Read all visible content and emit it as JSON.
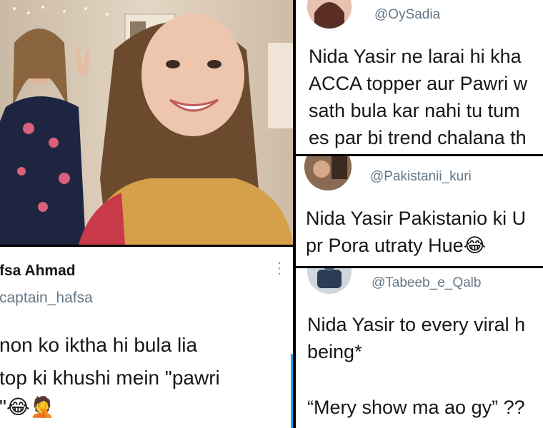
{
  "photo": {
    "description_icon": "photo-of-two-women"
  },
  "tweet_left": {
    "name": "fsa Ahmad",
    "handle": "captain_hafsa",
    "lines": [
      "non ko iktha hi bula lia",
      "top ki khushi mein \"pawri",
      "\""
    ],
    "emojis": "😂🤦"
  },
  "tweet_right_1": {
    "handle": "@OySadia",
    "lines": [
      "Nida Yasir ne larai hi kha",
      "ACCA topper aur Pawri w",
      "sath bula kar nahi tu tum",
      "es par bi trend chalana th"
    ]
  },
  "tweet_right_2": {
    "handle": "@Pakistanii_kuri",
    "lines": [
      "Nida Yasir Pakistanio ki U",
      "pr Pora utraty Hue"
    ],
    "emoji": "😂"
  },
  "tweet_right_3": {
    "handle": "@Tabeeb_e_Qalb",
    "lines": [
      "Nida Yasir to every viral h",
      "being*",
      "“Mery show ma ao gy” ??"
    ]
  },
  "colors": {
    "text": "#14171a",
    "handle": "#657786",
    "accent": "#1da1f2"
  }
}
